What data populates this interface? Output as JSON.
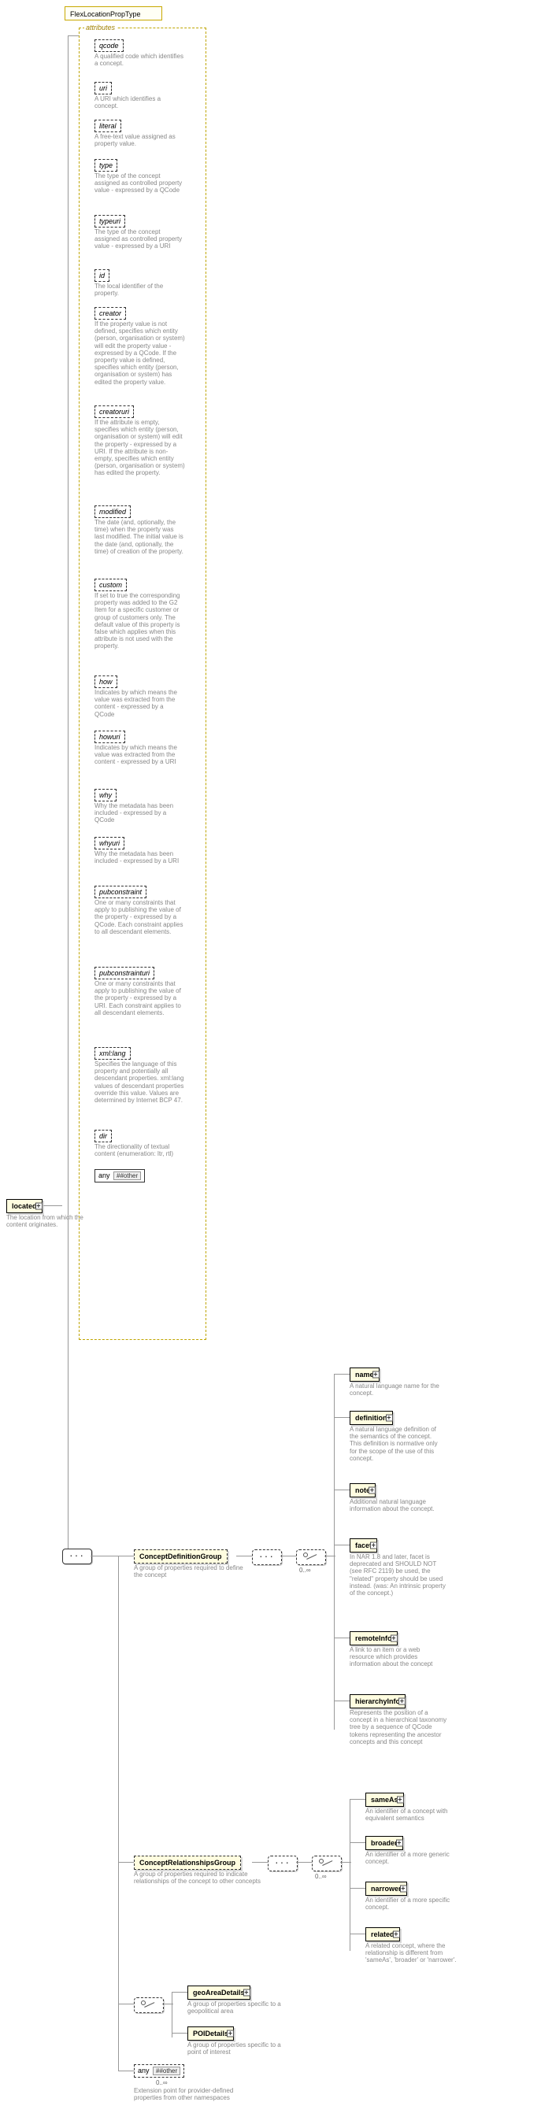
{
  "type_name": "FlexLocationPropType",
  "root": {
    "name": "located",
    "desc": "The location from which the content originates."
  },
  "attributes_label": "attributes",
  "attributes": [
    {
      "name": "qcode",
      "desc": "A qualified code which identifies a concept."
    },
    {
      "name": "uri",
      "desc": "A URI which identifies a concept."
    },
    {
      "name": "literal",
      "desc": "A free-text value assigned as property value."
    },
    {
      "name": "type",
      "desc": "The type of the concept assigned as controlled property value - expressed by a QCode"
    },
    {
      "name": "typeuri",
      "desc": "The type of the concept assigned as controlled property value - expressed by a URI"
    },
    {
      "name": "id",
      "desc": "The local identifier of the property."
    },
    {
      "name": "creator",
      "desc": "If the property value is not defined, specifies which entity (person, organisation or system) will edit the property value - expressed by a QCode. If the property value is defined, specifies which entity (person, organisation or system) has edited the property value."
    },
    {
      "name": "creatoruri",
      "desc": "If the attribute is empty, specifies which entity (person, organisation or system) will edit the property - expressed by a URI. If the attribute is non-empty, specifies which entity (person, organisation or system) has edited the property."
    },
    {
      "name": "modified",
      "desc": "The date (and, optionally, the time) when the property was last modified. The initial value is the date (and, optionally, the time) of creation of the property."
    },
    {
      "name": "custom",
      "desc": "If set to true the corresponding property was added to the G2 Item for a specific customer or group of customers only. The default value of this property is false which applies when this attribute is not used with the property."
    },
    {
      "name": "how",
      "desc": "Indicates by which means the value was extracted from the content - expressed by a QCode"
    },
    {
      "name": "howuri",
      "desc": "Indicates by which means the value was extracted from the content - expressed by a URI"
    },
    {
      "name": "why",
      "desc": "Why the metadata has been included - expressed by a QCode"
    },
    {
      "name": "whyuri",
      "desc": "Why the metadata has been included - expressed by a URI"
    },
    {
      "name": "pubconstraint",
      "desc": "One or many constraints that apply to publishing the value of the property - expressed by a QCode. Each constraint applies to all descendant elements."
    },
    {
      "name": "pubconstrainturi",
      "desc": "One or many constraints that apply to publishing the value of the property - expressed by a URI. Each constraint applies to all descendant elements."
    },
    {
      "name": "xml:lang",
      "desc": "Specifies the language of this property and potentially all descendant properties. xml:lang values of descendant properties override this value. Values are determined by Internet BCP 47."
    },
    {
      "name": "dir",
      "desc": "The directionality of textual content (enumeration: ltr, rtl)"
    }
  ],
  "attr_any": {
    "label": "any",
    "ns": "##other"
  },
  "groups": {
    "def": {
      "name": "ConceptDefinitionGroup",
      "desc": "A group of properties required to define the concept",
      "occ": "0..∞",
      "children": [
        {
          "name": "name",
          "desc": "A natural language name for the concept."
        },
        {
          "name": "definition",
          "desc": "A natural language definition of the semantics of the concept. This definition is normative only for the scope of the use of this concept."
        },
        {
          "name": "note",
          "desc": "Additional natural language information about the concept."
        },
        {
          "name": "facet",
          "desc": "In NAR 1.8 and later, facet is deprecated and SHOULD NOT (see RFC 2119) be used, the \"related\" property should be used instead. (was: An intrinsic property of the concept.)"
        },
        {
          "name": "remoteInfo",
          "desc": "A link to an item or a web resource which provides information about the concept"
        },
        {
          "name": "hierarchyInfo",
          "desc": "Represents the position of a concept in a hierarchical taxonomy tree by a sequence of QCode tokens representing the ancestor concepts and this concept"
        }
      ]
    },
    "rel": {
      "name": "ConceptRelationshipsGroup",
      "desc": "A group of properties required to indicate relationships of the concept to other concepts",
      "occ": "0..∞",
      "children": [
        {
          "name": "sameAs",
          "desc": "An identifier of a concept with equivalent semantics"
        },
        {
          "name": "broader",
          "desc": "An identifier of a more generic concept."
        },
        {
          "name": "narrower",
          "desc": "An identifier of a more specific concept."
        },
        {
          "name": "related",
          "desc": "A related concept, where the relationship is different from 'sameAs', 'broader' or 'narrower'."
        }
      ]
    }
  },
  "choice_children": [
    {
      "name": "geoAreaDetails",
      "desc": "A group of properties specific to a geopolitical area"
    },
    {
      "name": "POIDetails",
      "desc": "A group of properties specific to a point of interest"
    }
  ],
  "tail_any": {
    "label": "any",
    "ns": "##other",
    "occ": "0..∞",
    "desc": "Extension point for provider-defined properties from other namespaces"
  }
}
